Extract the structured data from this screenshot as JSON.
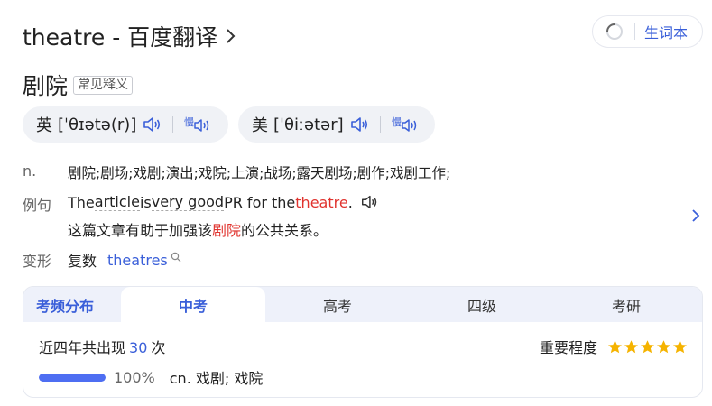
{
  "header": {
    "title": "theatre - 百度翻译",
    "vocab_label": "生词本"
  },
  "word": {
    "text": "剧院",
    "tag": "常见释义"
  },
  "pronunciations": [
    {
      "label": "英",
      "phonetic": "[ˈθɪətə(r)]"
    },
    {
      "label": "美",
      "phonetic": "[ˈθiːətər]"
    }
  ],
  "definition": {
    "pos": "n.",
    "text": "剧院;剧场;戏剧;演出;戏院;上演;战场;露天剧场;剧作;戏剧工作;"
  },
  "example": {
    "key": "例句",
    "en_parts": [
      "The ",
      "article",
      " is ",
      "very good",
      " PR for the ",
      "theatre",
      "."
    ],
    "cn_before": "这篇文章有助于加强该",
    "cn_highlight": "剧院",
    "cn_after": "的公共关系。"
  },
  "forms": {
    "key": "变形",
    "type": "复数",
    "value": "theatres"
  },
  "exam": {
    "tabs": [
      "考频分布",
      "中考",
      "高考",
      "四级",
      "考研"
    ],
    "active_tab": 1,
    "stat_prefix": "近四年共出现",
    "stat_count": "30",
    "stat_suffix": "次",
    "importance_label": "重要程度",
    "importance_stars": 5,
    "distribution": [
      {
        "percent": "100%",
        "fraction": 1.0,
        "meaning": "cn. 戏剧; 戏院"
      }
    ]
  },
  "colors": {
    "accent": "#3a5fd9",
    "highlight": "#e0332e",
    "star": "#f5b300",
    "bar": "#4e6ef2"
  }
}
